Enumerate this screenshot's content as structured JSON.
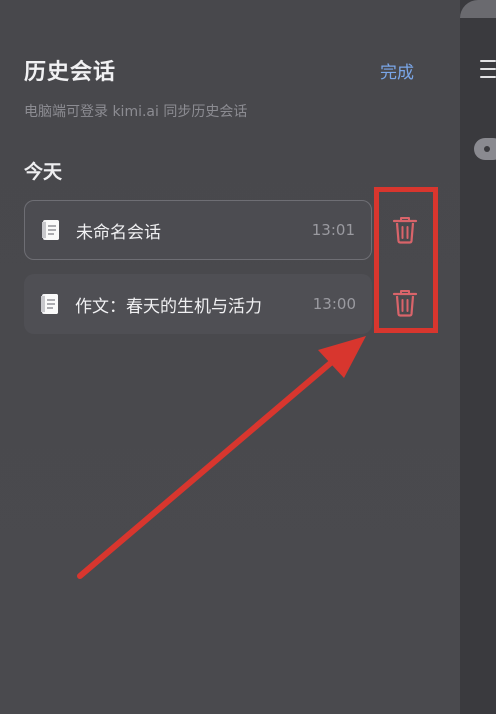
{
  "header": {
    "title": "历史会话",
    "done_label": "完成",
    "subtitle": "电脑端可登录 kimi.ai  同步历史会话"
  },
  "section": {
    "label": "今天"
  },
  "conversations": [
    {
      "title": "未命名会话",
      "time": "13:01",
      "selected": true
    },
    {
      "title": "作文：春天的生机与活力",
      "time": "13:00",
      "selected": false
    }
  ],
  "colors": {
    "panel_bg": "#48484c",
    "accent_link": "#7aa6e8",
    "trash_icon": "#d9646a",
    "annotation_red": "#d8362e"
  },
  "icons": {
    "conversation": "document-icon",
    "delete": "trash-icon",
    "menu": "hamburger-icon"
  }
}
